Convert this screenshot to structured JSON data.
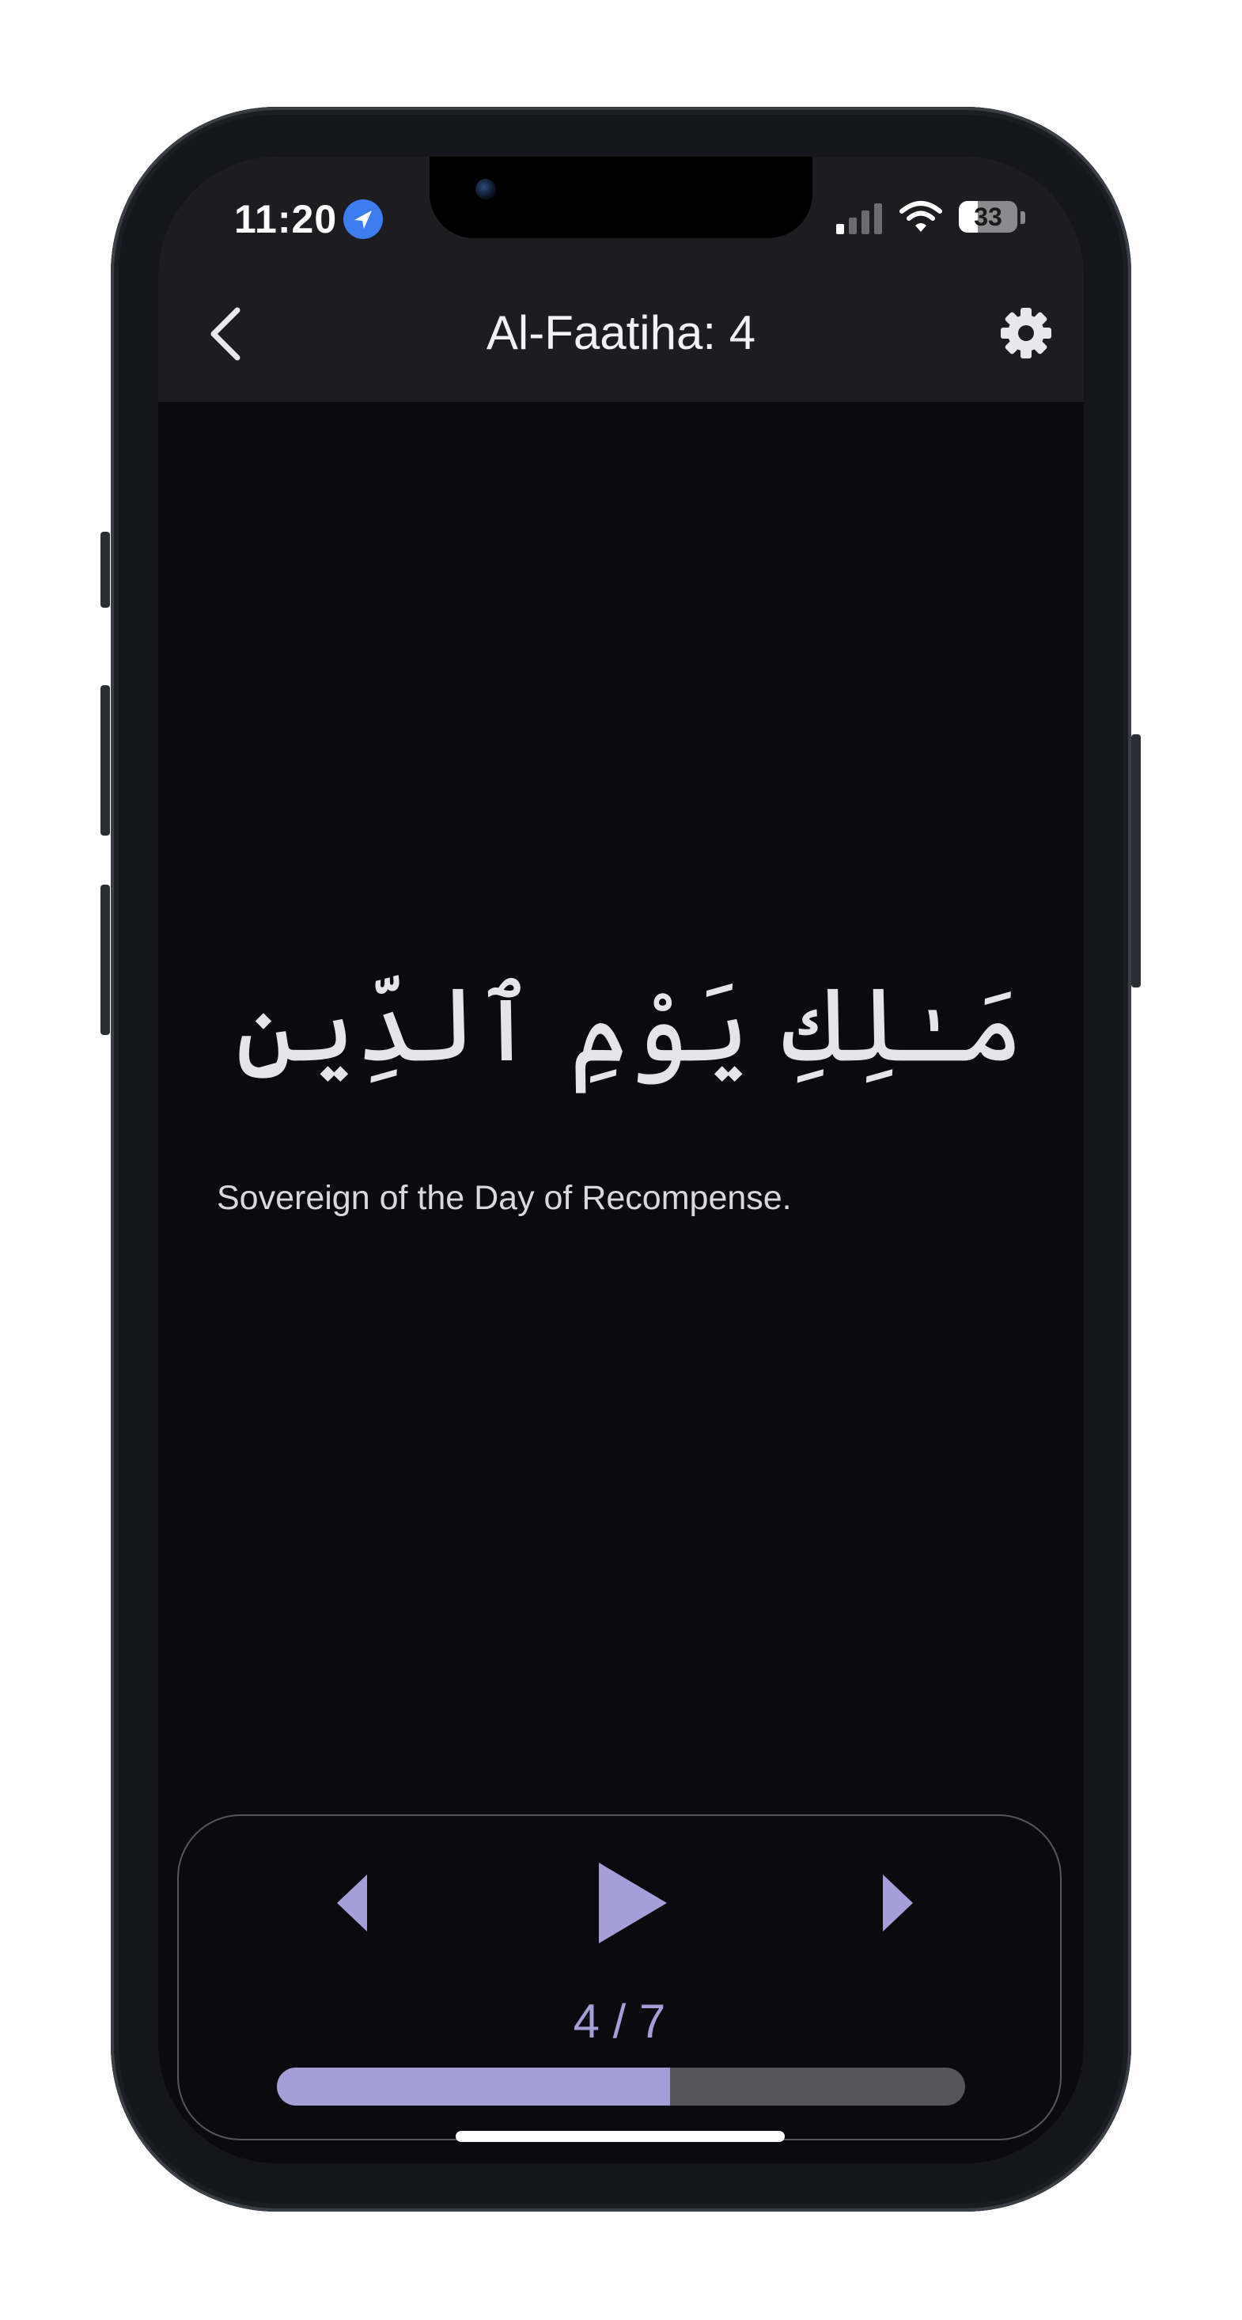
{
  "status_bar": {
    "time": "11:20",
    "battery_level": "33",
    "icons": [
      "location-arrow-icon",
      "cellular-signal-icon",
      "wifi-icon",
      "battery-icon"
    ]
  },
  "nav": {
    "title": "Al-Faatiha: 4",
    "back_icon": "chevron-left-icon",
    "settings_icon": "gear-icon"
  },
  "verse": {
    "arabic": "مَـٰلِكِ يَوْمِ ٱلدِّينِ",
    "translation": "Sovereign of the Day of Recompense."
  },
  "player": {
    "counter": "4 / 7",
    "progress_fraction": 0.571,
    "icons": [
      "previous-icon",
      "play-icon",
      "next-icon"
    ]
  },
  "colors": {
    "accent": "#a49fd8",
    "background": "#0b0b0f",
    "header": "#1c1c21",
    "track": "#55555a"
  }
}
